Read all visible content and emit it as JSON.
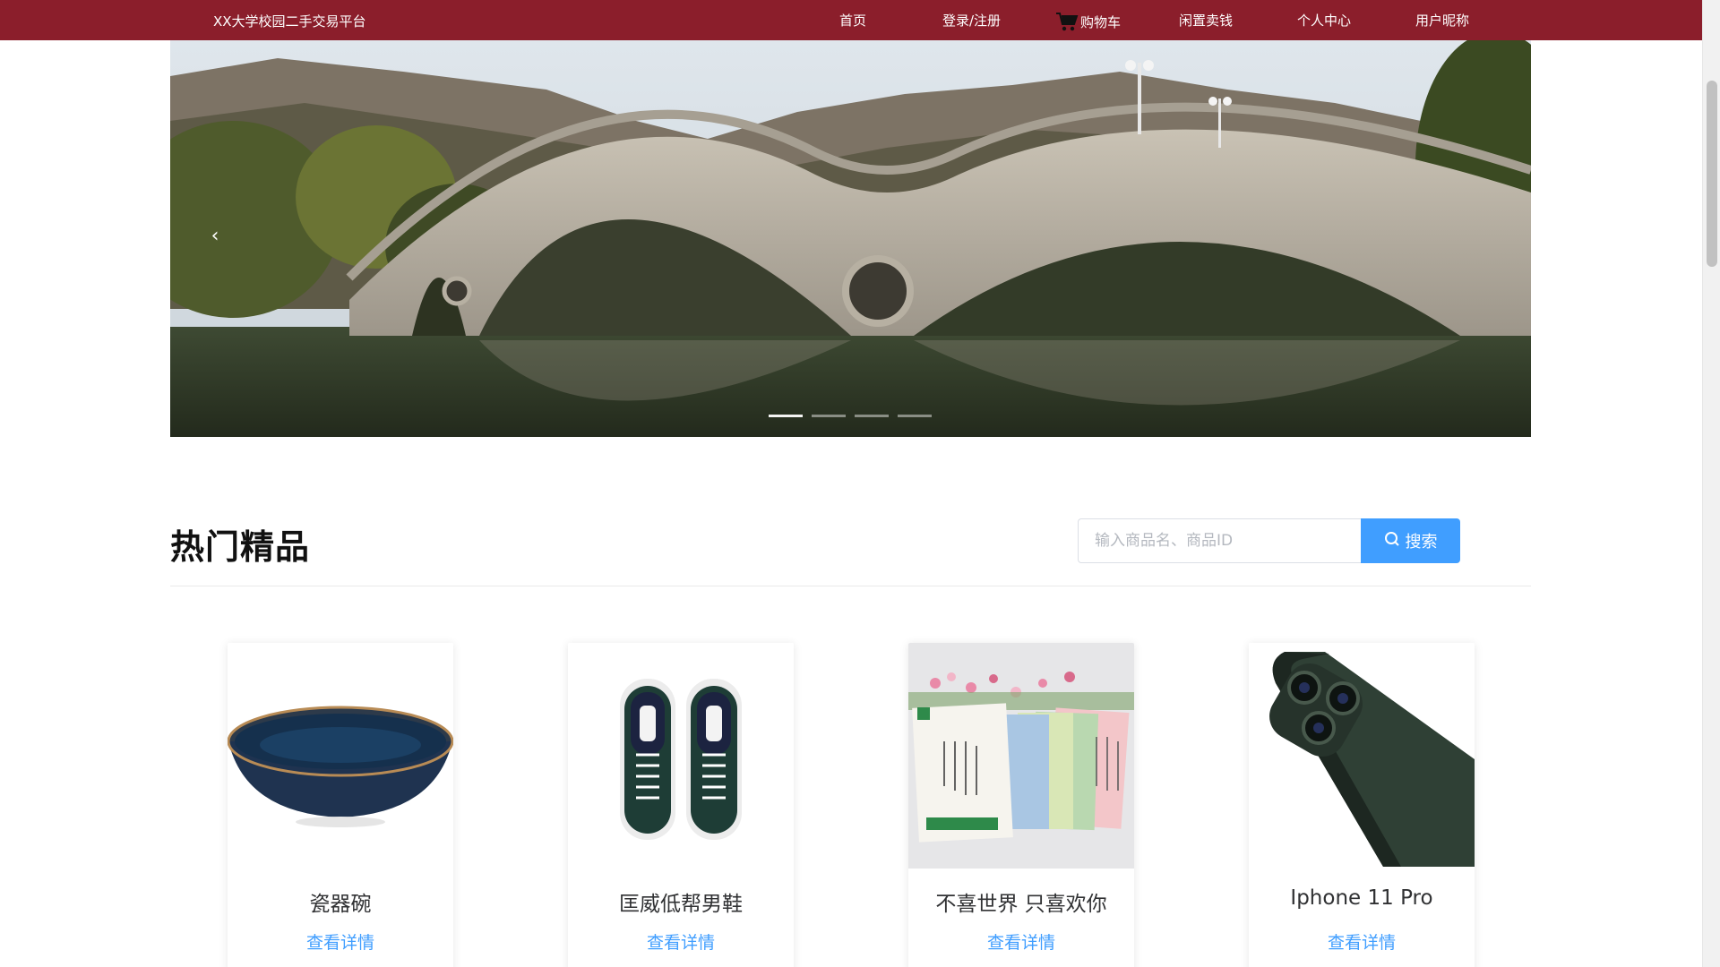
{
  "navbar": {
    "brand": "XX大学校园二手交易平台",
    "items": [
      {
        "label": "首页",
        "icon": ""
      },
      {
        "label": "登录/注册",
        "icon": ""
      },
      {
        "label": "购物车",
        "icon": "cart-icon"
      },
      {
        "label": "闲置卖钱",
        "icon": ""
      },
      {
        "label": "个人中心",
        "icon": ""
      },
      {
        "label": "用户昵称",
        "icon": ""
      }
    ]
  },
  "carousel": {
    "prev_arrow": "‹",
    "slide_count": 4,
    "active_index": 0
  },
  "section": {
    "title": "热门精品",
    "search_placeholder": "输入商品名、商品ID",
    "search_button": "搜索"
  },
  "products": [
    {
      "name": "瓷器碗",
      "link": "查看详情",
      "image": "bowl"
    },
    {
      "name": "匡威低帮男鞋",
      "link": "查看详情",
      "image": "sneakers"
    },
    {
      "name": "不喜世界 只喜欢你",
      "link": "查看详情",
      "image": "books"
    },
    {
      "name": "Iphone 11 Pro",
      "link": "查看详情",
      "image": "phone"
    }
  ],
  "colors": {
    "navbar": "#8b1e2b",
    "accent": "#409eff"
  }
}
